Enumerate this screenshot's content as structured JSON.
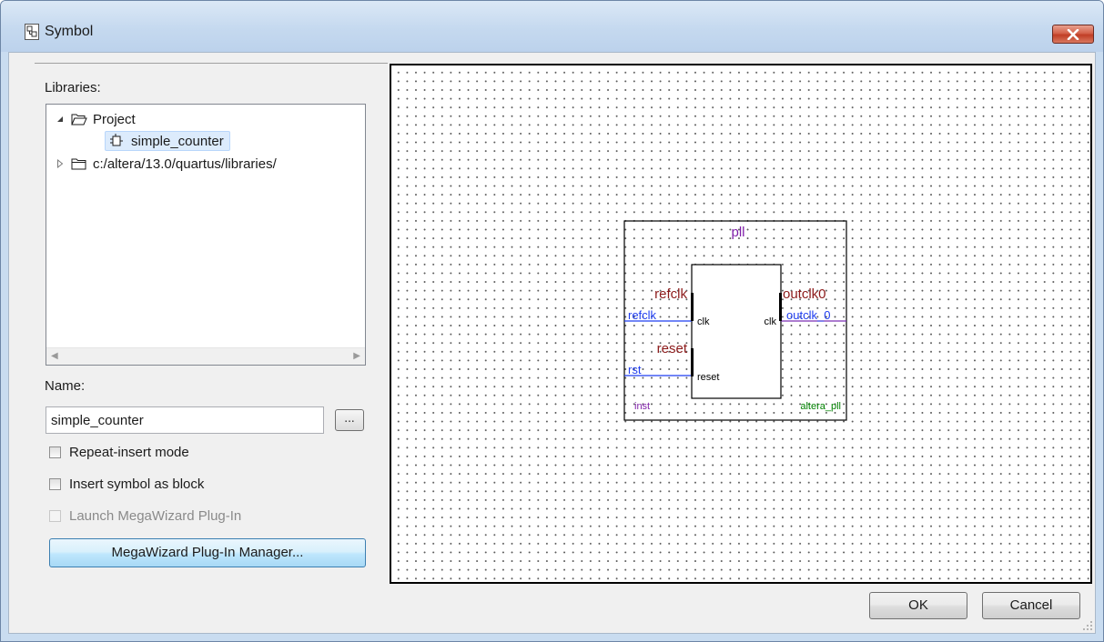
{
  "window": {
    "title": "Symbol",
    "close_icon": "close-icon"
  },
  "libraries": {
    "label": "Libraries:",
    "tree": [
      {
        "label": "Project",
        "expanded": true,
        "icon": "folder-open-icon"
      },
      {
        "label": "simple_counter",
        "selected": true,
        "icon": "symbol-icon"
      },
      {
        "label": "c:/altera/13.0/quartus/libraries/",
        "expanded": false,
        "icon": "folder-icon"
      }
    ]
  },
  "name": {
    "label": "Name:",
    "value": "simple_counter",
    "browse_label": "..."
  },
  "options": {
    "repeat_insert": {
      "label": "Repeat-insert mode",
      "checked": false,
      "enabled": true
    },
    "insert_block": {
      "label": "Insert symbol as block",
      "checked": false,
      "enabled": true
    },
    "launch_megawizard": {
      "label": "Launch MegaWizard Plug-In",
      "checked": false,
      "enabled": false
    }
  },
  "megawizard_button": "MegaWizard Plug-In Manager...",
  "symbol": {
    "block_name": "pll",
    "instance_name": "inst",
    "entity_name": "altera_pll",
    "ports": {
      "refclk": {
        "label": "refclk",
        "wire": "refclk",
        "pin": "clk"
      },
      "reset": {
        "label": "reset",
        "wire": "rst",
        "pin": "reset"
      },
      "outclk0": {
        "label": "outclk0",
        "wire": "outclk_0",
        "pin": "clk"
      }
    },
    "colors": {
      "port_label": "#8b1a1a",
      "wire": "#1f3df0",
      "wire_out": "#7b2fb3",
      "block_name": "#7f1fa8",
      "entity": "#008000"
    }
  },
  "buttons": {
    "ok": "OK",
    "cancel": "Cancel"
  }
}
